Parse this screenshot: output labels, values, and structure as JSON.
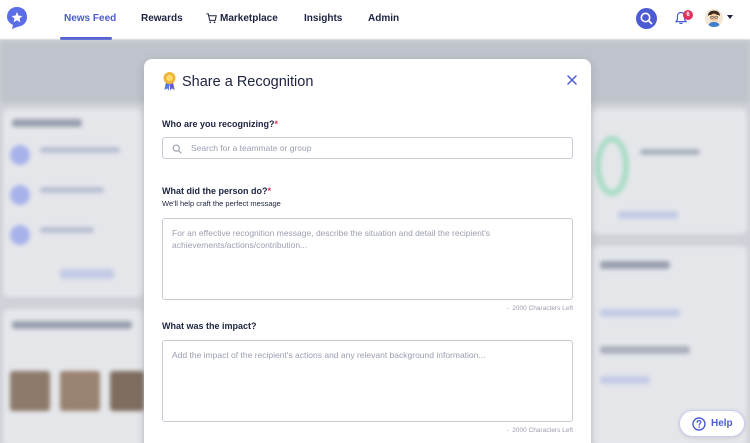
{
  "nav": {
    "items": [
      {
        "label": "News Feed",
        "active": true
      },
      {
        "label": "Rewards",
        "active": false
      },
      {
        "label": "Marketplace",
        "active": false
      },
      {
        "label": "Insights",
        "active": false
      },
      {
        "label": "Admin",
        "active": false
      }
    ],
    "notification_count": "6",
    "icons": [
      "logo-icon",
      "cart-icon",
      "search-icon",
      "bell-icon",
      "avatar",
      "caret-down-icon"
    ]
  },
  "modal": {
    "title": "Share a Recognition",
    "fields": {
      "who": {
        "label": "Who are you recognizing?",
        "required_mark": "*",
        "placeholder": "Search for a teammate or group",
        "value": ""
      },
      "what": {
        "label": "What did the person do?",
        "required_mark": "*",
        "sublabel": "We'll help craft the perfect message",
        "placeholder": "For an effective recognition message, describe the situation and detail the recipient's achievements/actions/contribution...",
        "value": "",
        "counter": "2000 Characters Left"
      },
      "impact": {
        "label": "What was the impact?",
        "placeholder": "Add the impact of the recipient's actions and any relevant background information...",
        "value": "",
        "counter": "2000 Characters Left"
      }
    }
  },
  "help": {
    "label": "Help"
  },
  "colors": {
    "accent": "#4c5bd4",
    "badge": "#e0325c",
    "text": "#1c2340",
    "placeholder": "#9a9eb0"
  }
}
